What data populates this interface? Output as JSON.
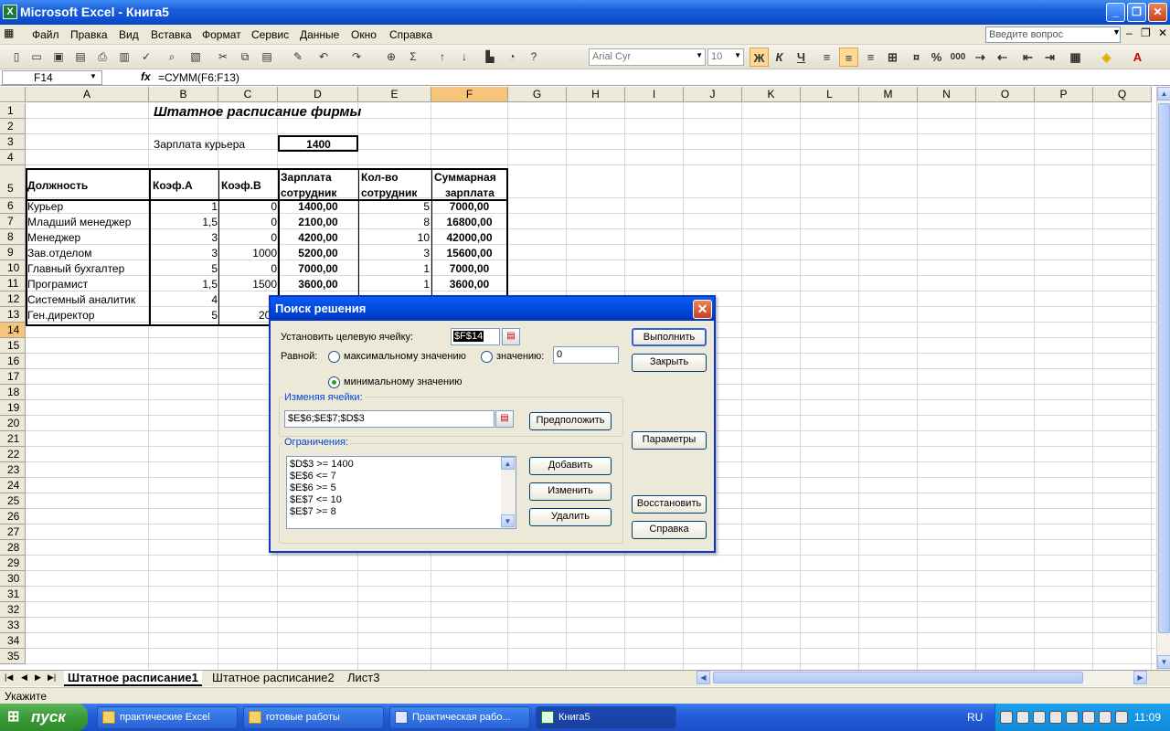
{
  "window": {
    "title": "Microsoft Excel - Книга5"
  },
  "menu": {
    "items": [
      "Файл",
      "Правка",
      "Вид",
      "Вставка",
      "Формат",
      "Сервис",
      "Данные",
      "Окно",
      "Справка"
    ],
    "help_placeholder": "Введите вопрос"
  },
  "toolbar": {
    "font": "Arial Cyr",
    "size": "10",
    "bold": "Ж",
    "italic": "К",
    "underline": "Ч",
    "percent": "%",
    "thousands": "000"
  },
  "formula_bar": {
    "cell": "F14",
    "fx": "fx",
    "formula": "=СУММ(F6:F13)"
  },
  "columns": [
    "A",
    "B",
    "C",
    "D",
    "E",
    "F",
    "G",
    "H",
    "I",
    "J",
    "K",
    "L",
    "M",
    "N",
    "O",
    "P",
    "Q"
  ],
  "rows": [
    "1",
    "2",
    "3",
    "4",
    "5",
    "6",
    "7",
    "8",
    "9",
    "10",
    "11",
    "12",
    "13",
    "14",
    "15",
    "16",
    "17",
    "18",
    "19",
    "20",
    "21",
    "22",
    "23",
    "24",
    "25",
    "26",
    "27",
    "28",
    "29",
    "30",
    "31",
    "32",
    "33",
    "34",
    "35"
  ],
  "sheet": {
    "title": "Штатное расписание фирмы",
    "courier_label": "Зарплата курьера",
    "courier_value": "1400",
    "headers": {
      "a": "Должность",
      "b": "Коэф.А",
      "c": "Коэф.В",
      "d1": "Зарплата",
      "d2": "сотрудник",
      "e1": "Кол-во",
      "e2": "сотрудник",
      "f1": "Суммарная",
      "f2": "зарплата"
    },
    "data": [
      {
        "a": "Курьер",
        "b": "1",
        "c": "0",
        "d": "1400,00",
        "e": "5",
        "f": "7000,00"
      },
      {
        "a": "Младший менеджер",
        "b": "1,5",
        "c": "0",
        "d": "2100,00",
        "e": "8",
        "f": "16800,00"
      },
      {
        "a": "Менеджер",
        "b": "3",
        "c": "0",
        "d": "4200,00",
        "e": "10",
        "f": "42000,00"
      },
      {
        "a": "Зав.отделом",
        "b": "3",
        "c": "1000",
        "d": "5200,00",
        "e": "3",
        "f": "15600,00"
      },
      {
        "a": "Главный бухгалтер",
        "b": "5",
        "c": "0",
        "d": "7000,00",
        "e": "1",
        "f": "7000,00"
      },
      {
        "a": "Програмист",
        "b": "1,5",
        "c": "1500",
        "d": "3600,00",
        "e": "1",
        "f": "3600,00"
      },
      {
        "a": "Системный аналитик",
        "b": "4",
        "c": "",
        "d": "",
        "e": "",
        "f": ""
      },
      {
        "a": "Ген.директор",
        "b": "5",
        "c": "200",
        "d": "",
        "e": "",
        "f": ""
      }
    ]
  },
  "tabs": [
    "Штатное расписание1",
    "Штатное расписание2",
    "Лист3"
  ],
  "status": "Укажите",
  "dialog": {
    "title": "Поиск решения",
    "target_label": "Установить целевую ячейку:",
    "target_value": "$F$14",
    "equal_label": "Равной:",
    "max_label": "максимальному значению",
    "value_label": "значению:",
    "value_input": "0",
    "min_label": "минимальному значению",
    "changing_label": "Изменяя ячейки:",
    "changing_value": "$E$6;$E$7;$D$3",
    "constraints_label": "Ограничения:",
    "constraints": [
      "$D$3 >= 1400",
      "$E$6 <= 7",
      "$E$6 >= 5",
      "$E$7 <= 10",
      "$E$7 >= 8"
    ],
    "buttons": {
      "run": "Выполнить",
      "close": "Закрыть",
      "guess": "Предположить",
      "options": "Параметры",
      "add": "Добавить",
      "change": "Изменить",
      "delete": "Удалить",
      "reset": "Восстановить",
      "help": "Справка"
    }
  },
  "taskbar": {
    "start": "пуск",
    "tasks": [
      "практические Excel",
      "готовые работы",
      "Практическая рабо...",
      "Книга5"
    ],
    "lang": "RU",
    "clock": "11:09"
  }
}
